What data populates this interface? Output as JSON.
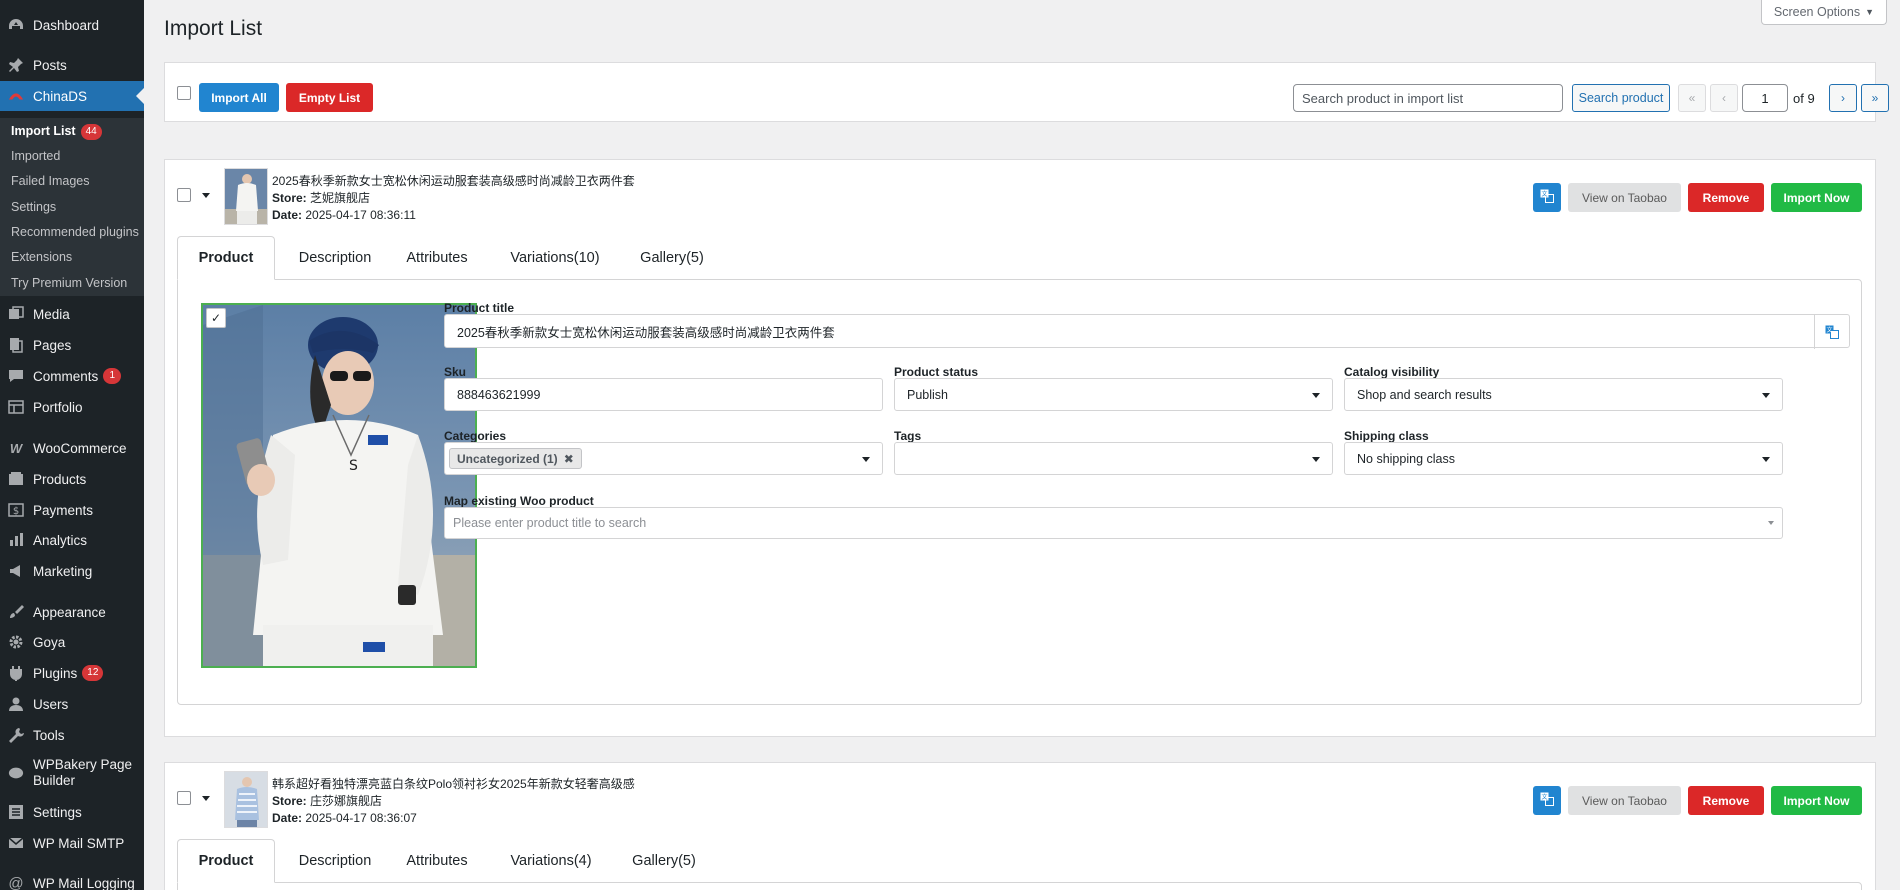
{
  "sidebar": {
    "menu": [
      {
        "label": "Dashboard",
        "icon": "dashboard-icon"
      },
      {
        "label": "Posts",
        "icon": "pin-icon"
      },
      {
        "label": "ChinaDS",
        "icon": "chinads-icon"
      },
      {
        "label": "Media",
        "icon": "media-icon"
      },
      {
        "label": "Pages",
        "icon": "pages-icon"
      },
      {
        "label": "Comments",
        "icon": "comments-icon",
        "badge": "1"
      },
      {
        "label": "Portfolio",
        "icon": "portfolio-icon"
      },
      {
        "label": "WooCommerce",
        "icon": "woocommerce-icon"
      },
      {
        "label": "Products",
        "icon": "products-icon"
      },
      {
        "label": "Payments",
        "icon": "payments-icon"
      },
      {
        "label": "Analytics",
        "icon": "analytics-icon"
      },
      {
        "label": "Marketing",
        "icon": "marketing-icon"
      },
      {
        "label": "Appearance",
        "icon": "appearance-icon"
      },
      {
        "label": "Goya",
        "icon": "gear-icon"
      },
      {
        "label": "Plugins",
        "icon": "plugins-icon",
        "badge": "12"
      },
      {
        "label": "Users",
        "icon": "users-icon"
      },
      {
        "label": "Tools",
        "icon": "tools-icon"
      },
      {
        "label": "WPBakery Page",
        "label2": "Builder",
        "icon": "wpbakery-icon"
      },
      {
        "label": "Settings",
        "icon": "settings-icon"
      },
      {
        "label": "WP Mail SMTP",
        "icon": "mail-icon"
      },
      {
        "label": "WP Mail Logging",
        "icon": "at-icon"
      }
    ],
    "submenu": [
      {
        "label": "Import List",
        "badge": "44"
      },
      {
        "label": "Imported"
      },
      {
        "label": "Failed Images"
      },
      {
        "label": "Settings"
      },
      {
        "label": "Recommended plugins"
      },
      {
        "label": "Extensions"
      },
      {
        "label": "Try Premium Version"
      }
    ]
  },
  "header": {
    "title": "Import List",
    "screen_options": "Screen Options"
  },
  "toolbar": {
    "import_all": "Import All",
    "empty_list": "Empty List",
    "search_placeholder": "Search product in import list",
    "search_button": "Search product",
    "pagination": {
      "first": "«",
      "prev": "‹",
      "current": "1",
      "total": "of 9",
      "next": "›",
      "last": "»"
    }
  },
  "colors": {
    "blue": "#2185d0",
    "red": "#db2828",
    "green": "#21ba45",
    "wp_blue": "#2271b1",
    "sidebar": "#1d2327"
  },
  "products": [
    {
      "title": "2025春秋季新款女士宽松休闲运动服套装高级感时尚减龄卫衣两件套",
      "store_label": "Store:",
      "store": "芝妮旗舰店",
      "date_label": "Date:",
      "date": "2025-04-17 08:36:11",
      "buttons": {
        "view": "View on Taobao",
        "remove": "Remove",
        "import": "Import Now"
      },
      "tabs": [
        "Product",
        "Description",
        "Attributes",
        "Variations(10)",
        "Gallery(5)"
      ],
      "form": {
        "title_label": "Product title",
        "title_value": "2025春秋季新款女士宽松休闲运动服套装高级感时尚减龄卫衣两件套",
        "sku_label": "Sku",
        "sku_value": "888463621999",
        "status_label": "Product status",
        "status_value": "Publish",
        "visibility_label": "Catalog visibility",
        "visibility_value": "Shop and search results",
        "categories_label": "Categories",
        "category_chip": "Uncategorized (1)",
        "tags_label": "Tags",
        "tags_value": "",
        "shipping_label": "Shipping class",
        "shipping_value": "No shipping class",
        "map_label": "Map existing Woo product",
        "map_placeholder": "Please enter product title to search"
      }
    },
    {
      "title": "韩系超好看独特漂亮蓝白条纹Polo领衬衫女2025年新款女轻奢高级感",
      "store_label": "Store:",
      "store": "庄莎娜旗舰店",
      "date_label": "Date:",
      "date": "2025-04-17 08:36:07",
      "buttons": {
        "view": "View on Taobao",
        "remove": "Remove",
        "import": "Import Now"
      },
      "tabs": [
        "Product",
        "Description",
        "Attributes",
        "Variations(4)",
        "Gallery(5)"
      ]
    }
  ]
}
